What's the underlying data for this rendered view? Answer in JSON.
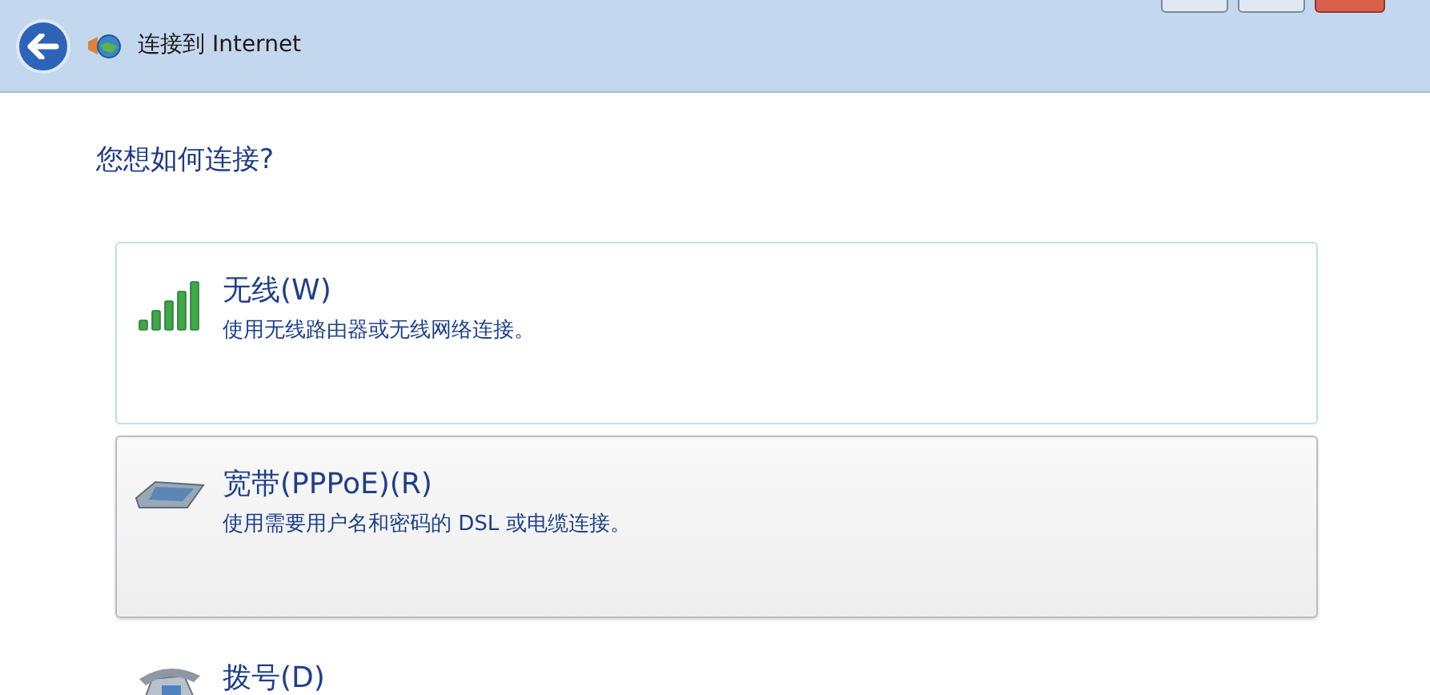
{
  "window": {
    "title": "连接到 Internet"
  },
  "heading": "您想如何连接?",
  "options": [
    {
      "kind": "wireless",
      "title": "无线(W)",
      "description": "使用无线路由器或无线网络连接。",
      "focused": true,
      "hovered": false
    },
    {
      "kind": "broadband",
      "title": "宽带(PPPoE)(R)",
      "description": "使用需要用户名和密码的 DSL 或电缆连接。",
      "focused": false,
      "hovered": true
    },
    {
      "kind": "dialup",
      "title": "拨号(D)",
      "focused": false,
      "hovered": false
    }
  ]
}
